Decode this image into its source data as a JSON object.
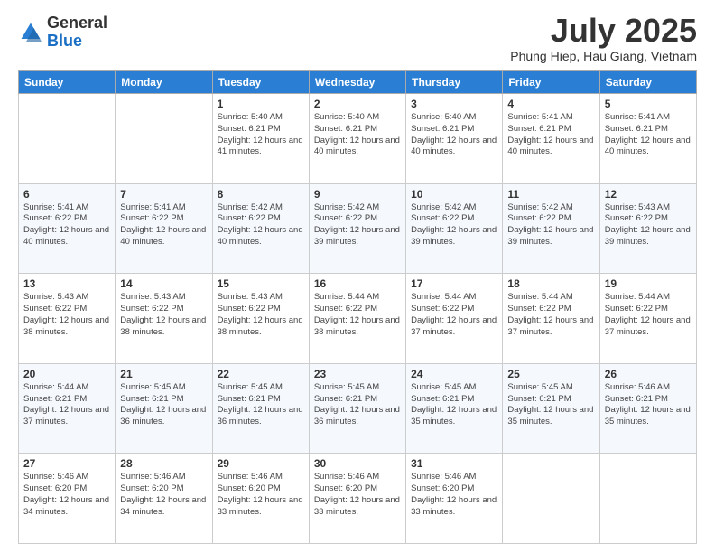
{
  "header": {
    "logo_general": "General",
    "logo_blue": "Blue",
    "month_title": "July 2025",
    "location": "Phung Hiep, Hau Giang, Vietnam"
  },
  "days_of_week": [
    "Sunday",
    "Monday",
    "Tuesday",
    "Wednesday",
    "Thursday",
    "Friday",
    "Saturday"
  ],
  "weeks": [
    [
      {
        "day": "",
        "info": ""
      },
      {
        "day": "",
        "info": ""
      },
      {
        "day": "1",
        "info": "Sunrise: 5:40 AM\nSunset: 6:21 PM\nDaylight: 12 hours and 41 minutes."
      },
      {
        "day": "2",
        "info": "Sunrise: 5:40 AM\nSunset: 6:21 PM\nDaylight: 12 hours and 40 minutes."
      },
      {
        "day": "3",
        "info": "Sunrise: 5:40 AM\nSunset: 6:21 PM\nDaylight: 12 hours and 40 minutes."
      },
      {
        "day": "4",
        "info": "Sunrise: 5:41 AM\nSunset: 6:21 PM\nDaylight: 12 hours and 40 minutes."
      },
      {
        "day": "5",
        "info": "Sunrise: 5:41 AM\nSunset: 6:21 PM\nDaylight: 12 hours and 40 minutes."
      }
    ],
    [
      {
        "day": "6",
        "info": "Sunrise: 5:41 AM\nSunset: 6:22 PM\nDaylight: 12 hours and 40 minutes."
      },
      {
        "day": "7",
        "info": "Sunrise: 5:41 AM\nSunset: 6:22 PM\nDaylight: 12 hours and 40 minutes."
      },
      {
        "day": "8",
        "info": "Sunrise: 5:42 AM\nSunset: 6:22 PM\nDaylight: 12 hours and 40 minutes."
      },
      {
        "day": "9",
        "info": "Sunrise: 5:42 AM\nSunset: 6:22 PM\nDaylight: 12 hours and 39 minutes."
      },
      {
        "day": "10",
        "info": "Sunrise: 5:42 AM\nSunset: 6:22 PM\nDaylight: 12 hours and 39 minutes."
      },
      {
        "day": "11",
        "info": "Sunrise: 5:42 AM\nSunset: 6:22 PM\nDaylight: 12 hours and 39 minutes."
      },
      {
        "day": "12",
        "info": "Sunrise: 5:43 AM\nSunset: 6:22 PM\nDaylight: 12 hours and 39 minutes."
      }
    ],
    [
      {
        "day": "13",
        "info": "Sunrise: 5:43 AM\nSunset: 6:22 PM\nDaylight: 12 hours and 38 minutes."
      },
      {
        "day": "14",
        "info": "Sunrise: 5:43 AM\nSunset: 6:22 PM\nDaylight: 12 hours and 38 minutes."
      },
      {
        "day": "15",
        "info": "Sunrise: 5:43 AM\nSunset: 6:22 PM\nDaylight: 12 hours and 38 minutes."
      },
      {
        "day": "16",
        "info": "Sunrise: 5:44 AM\nSunset: 6:22 PM\nDaylight: 12 hours and 38 minutes."
      },
      {
        "day": "17",
        "info": "Sunrise: 5:44 AM\nSunset: 6:22 PM\nDaylight: 12 hours and 37 minutes."
      },
      {
        "day": "18",
        "info": "Sunrise: 5:44 AM\nSunset: 6:22 PM\nDaylight: 12 hours and 37 minutes."
      },
      {
        "day": "19",
        "info": "Sunrise: 5:44 AM\nSunset: 6:22 PM\nDaylight: 12 hours and 37 minutes."
      }
    ],
    [
      {
        "day": "20",
        "info": "Sunrise: 5:44 AM\nSunset: 6:21 PM\nDaylight: 12 hours and 37 minutes."
      },
      {
        "day": "21",
        "info": "Sunrise: 5:45 AM\nSunset: 6:21 PM\nDaylight: 12 hours and 36 minutes."
      },
      {
        "day": "22",
        "info": "Sunrise: 5:45 AM\nSunset: 6:21 PM\nDaylight: 12 hours and 36 minutes."
      },
      {
        "day": "23",
        "info": "Sunrise: 5:45 AM\nSunset: 6:21 PM\nDaylight: 12 hours and 36 minutes."
      },
      {
        "day": "24",
        "info": "Sunrise: 5:45 AM\nSunset: 6:21 PM\nDaylight: 12 hours and 35 minutes."
      },
      {
        "day": "25",
        "info": "Sunrise: 5:45 AM\nSunset: 6:21 PM\nDaylight: 12 hours and 35 minutes."
      },
      {
        "day": "26",
        "info": "Sunrise: 5:46 AM\nSunset: 6:21 PM\nDaylight: 12 hours and 35 minutes."
      }
    ],
    [
      {
        "day": "27",
        "info": "Sunrise: 5:46 AM\nSunset: 6:20 PM\nDaylight: 12 hours and 34 minutes."
      },
      {
        "day": "28",
        "info": "Sunrise: 5:46 AM\nSunset: 6:20 PM\nDaylight: 12 hours and 34 minutes."
      },
      {
        "day": "29",
        "info": "Sunrise: 5:46 AM\nSunset: 6:20 PM\nDaylight: 12 hours and 33 minutes."
      },
      {
        "day": "30",
        "info": "Sunrise: 5:46 AM\nSunset: 6:20 PM\nDaylight: 12 hours and 33 minutes."
      },
      {
        "day": "31",
        "info": "Sunrise: 5:46 AM\nSunset: 6:20 PM\nDaylight: 12 hours and 33 minutes."
      },
      {
        "day": "",
        "info": ""
      },
      {
        "day": "",
        "info": ""
      }
    ]
  ]
}
